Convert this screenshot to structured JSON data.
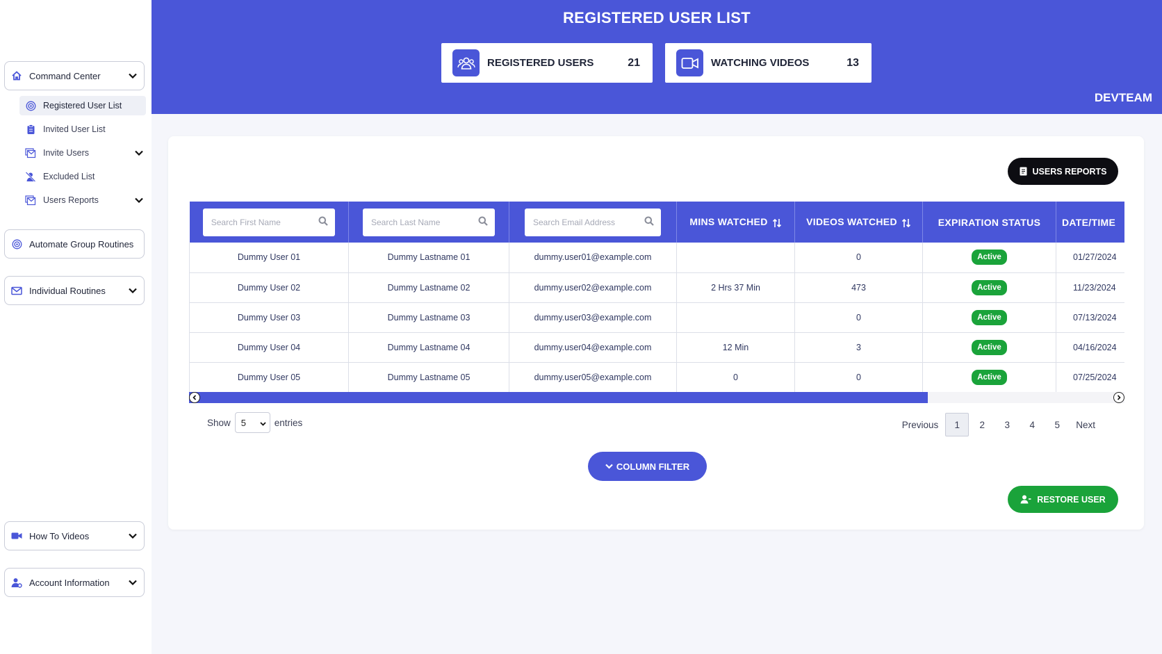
{
  "sidebar": {
    "command_center": "Command Center",
    "submenu": [
      {
        "label": "Registered User List",
        "icon": "target-icon",
        "active": true
      },
      {
        "label": "Invited User List",
        "icon": "clipboard-icon"
      },
      {
        "label": "Invite Users",
        "icon": "mail-stack-icon",
        "expandable": true
      },
      {
        "label": "Excluded List",
        "icon": "user-slash-icon"
      },
      {
        "label": "Users Reports",
        "icon": "mail-stack-icon",
        "expandable": true
      }
    ],
    "automate_group_routines": "Automate Group Routines",
    "individual_routines": "Individual Routines",
    "how_to_videos": "How To Videos",
    "account_information": "Account Information"
  },
  "header": {
    "title": "REGISTERED USER LIST",
    "registered_users_label": "REGISTERED USERS",
    "registered_users_count": "21",
    "watching_videos_label": "WATCHING VIDEOS",
    "watching_videos_count": "13",
    "org": "DEVTEAM"
  },
  "toolbar": {
    "users_reports": "USERS REPORTS"
  },
  "table": {
    "search": {
      "first_name": "Search First Name",
      "last_name": "Search Last Name",
      "email": "Search Email Address"
    },
    "columns": {
      "mins_watched": "MINS WATCHED",
      "videos_watched": "VIDEOS WATCHED",
      "expiration_status": "EXPIRATION STATUS",
      "date_time": "DATE/TIME"
    },
    "rows": [
      {
        "first": "Dummy User 01",
        "last": "Dummy Lastname 01",
        "email": "dummy.user01@example.com",
        "mins": "",
        "videos": "0",
        "status": "Active",
        "date": "01/27/2024"
      },
      {
        "first": "Dummy User 02",
        "last": "Dummy Lastname 02",
        "email": "dummy.user02@example.com",
        "mins": "2 Hrs 37 Min",
        "videos": "473",
        "status": "Active",
        "date": "11/23/2024"
      },
      {
        "first": "Dummy User 03",
        "last": "Dummy Lastname 03",
        "email": "dummy.user03@example.com",
        "mins": "",
        "videos": "0",
        "status": "Active",
        "date": "07/13/2024"
      },
      {
        "first": "Dummy User 04",
        "last": "Dummy Lastname 04",
        "email": "dummy.user04@example.com",
        "mins": "12 Min",
        "videos": "3",
        "status": "Active",
        "date": "04/16/2024"
      },
      {
        "first": "Dummy User 05",
        "last": "Dummy Lastname 05",
        "email": "dummy.user05@example.com",
        "mins": "0",
        "videos": "0",
        "status": "Active",
        "date": "07/25/2024"
      }
    ]
  },
  "pagination": {
    "show": "Show",
    "entries_value": "5",
    "entries": "entries",
    "previous": "Previous",
    "pages": [
      "1",
      "2",
      "3",
      "4",
      "5"
    ],
    "current": "1",
    "next": "Next"
  },
  "actions": {
    "column_filter": "COLUMN FILTER",
    "restore_user": "RESTORE USER"
  },
  "colors": {
    "primary": "#4a56d8",
    "success": "#1aa33a",
    "dark": "#0d0d12"
  }
}
